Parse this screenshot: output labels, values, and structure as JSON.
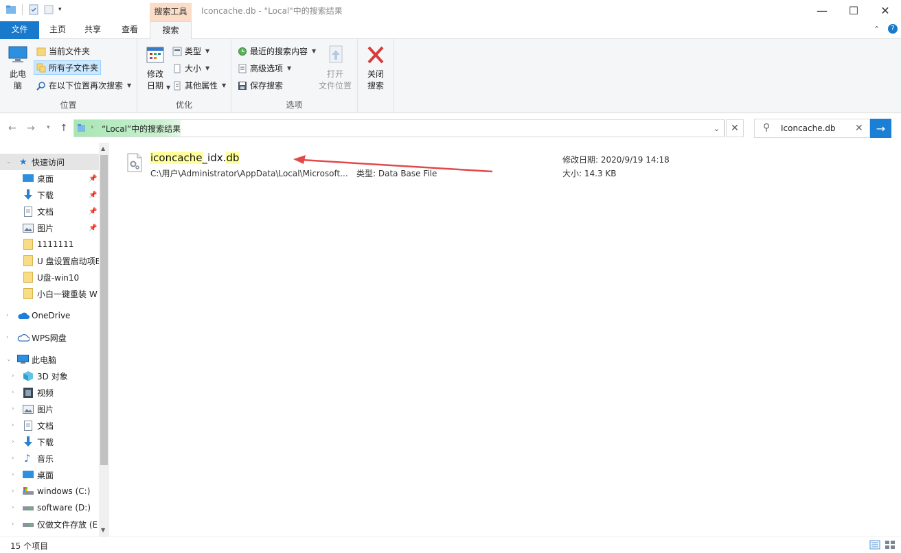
{
  "title_bar": {
    "context_tab": "搜索工具",
    "window_title": "Iconcache.db - \"Local\"中的搜索结果",
    "minimize": "—",
    "maximize": "☐",
    "close": "✕"
  },
  "tabs": [
    {
      "label": "文件"
    },
    {
      "label": "主页"
    },
    {
      "label": "共享"
    },
    {
      "label": "查看"
    },
    {
      "label": "搜索"
    }
  ],
  "ribbon": {
    "location_group": {
      "label": "位置",
      "this_pc": "此电\n脑",
      "current_folder": "当前文件夹",
      "all_subfolders": "所有子文件夹",
      "search_again": "在以下位置再次搜索"
    },
    "refine_group": {
      "label": "优化",
      "date_modified": "修改\n日期",
      "type": "类型",
      "size": "大小",
      "other_props": "其他属性"
    },
    "options_group": {
      "label": "选项",
      "recent_searches": "最近的搜索内容",
      "advanced": "高级选项",
      "save_search": "保存搜索",
      "open_location": "打开\n文件位置"
    },
    "close_group": {
      "close_search": "关闭\n搜索"
    }
  },
  "address": {
    "path": "“Local”中的搜索结果",
    "search_value": "Iconcache.db"
  },
  "sidebar": {
    "quick_access": "快速访问",
    "quick_items": [
      "桌面",
      "下载",
      "文档",
      "图片",
      "1111111",
      "U 盘设置启动项B",
      "U盘-win10",
      "小白一键重装 W"
    ],
    "onedrive": "OneDrive",
    "wps": "WPS网盘",
    "this_pc": "此电脑",
    "pc_items": [
      "3D 对象",
      "视频",
      "图片",
      "文档",
      "下载",
      "音乐",
      "桌面",
      "windows (C:)",
      "software (D:)",
      "仅做文件存放 (E"
    ]
  },
  "result": {
    "name_part1": "iconcache",
    "name_part2": "_idx.",
    "name_part3": "db",
    "path": "C:\\用户\\Administrator\\AppData\\Local\\Microsoft...",
    "type": "类型: Data Base File",
    "modified": "修改日期: 2020/9/19 14:18",
    "size": "大小: 14.3 KB"
  },
  "status": {
    "count": "15 个项目"
  },
  "colors": {
    "accent": "#1979ca",
    "arrow": "#e04a4a",
    "highlight": "#ffff9b"
  }
}
